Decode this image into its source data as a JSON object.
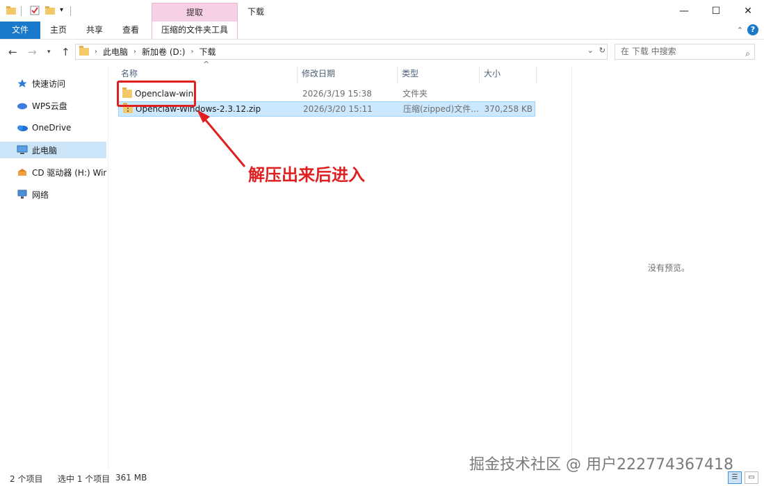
{
  "titlebar": {
    "context_tab_header": "提取",
    "window_title": "下载",
    "minimize": "—",
    "maximize": "☐",
    "close": "✕"
  },
  "ribbon": {
    "tabs": [
      "文件",
      "主页",
      "共享",
      "查看",
      "压缩的文件夹工具"
    ],
    "expand": "⌃",
    "help": "?"
  },
  "address": {
    "crumbs": [
      "此电脑",
      "新加卷 (D:)",
      "下载"
    ],
    "search_placeholder": "在 下载 中搜索"
  },
  "navpane": {
    "items": [
      {
        "label": "快速访问",
        "icon": "star-icon"
      },
      {
        "label": "WPS云盘",
        "icon": "cloud-icon"
      },
      {
        "label": "OneDrive",
        "icon": "onedrive-icon"
      },
      {
        "label": "此电脑",
        "icon": "computer-icon"
      },
      {
        "label": "CD 驱动器 (H:) Wind",
        "icon": "cd-drive-icon"
      },
      {
        "label": "网络",
        "icon": "network-icon"
      }
    ]
  },
  "columns": [
    "名称",
    "修改日期",
    "类型",
    "大小"
  ],
  "files": [
    {
      "name": "Openclaw-win",
      "date": "2026/3/19 15:38",
      "type": "文件夹",
      "size": ""
    },
    {
      "name": "Openclaw-Windows-2.3.12.zip",
      "date": "2026/3/20 15:11",
      "type": "压缩(zipped)文件...",
      "size": "370,258 KB"
    }
  ],
  "annotation": {
    "text": "解压出来后进入",
    "color": "#e02020"
  },
  "preview": {
    "text": "没有预览。"
  },
  "status": {
    "count": "2 个项目",
    "selected": "选中 1 个项目",
    "size": "361 MB"
  },
  "watermark": "掘金技术社区 @ 用户2227743674​18",
  "colors": {
    "accent": "#1979ca",
    "context_tab": "#f8d0e6",
    "selection": "#cce8ff"
  }
}
